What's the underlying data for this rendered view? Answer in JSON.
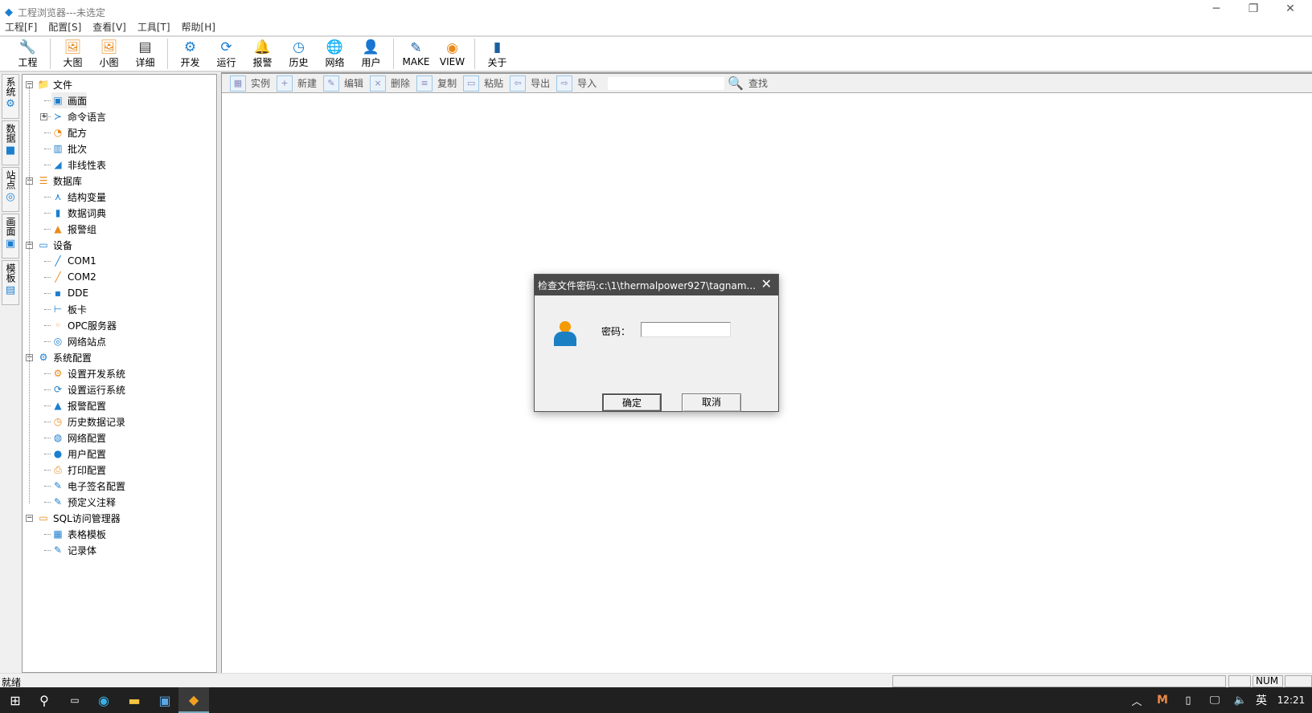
{
  "window": {
    "title": "工程浏览器---未选定",
    "minimize": "─",
    "restore": "❐",
    "close": "✕"
  },
  "menu": [
    "工程[F]",
    "配置[S]",
    "查看[V]",
    "工具[T]",
    "帮助[H]"
  ],
  "toolbar": [
    {
      "label": "工程",
      "icon": "wrench-icon",
      "glyph": "🔧",
      "sep": false
    },
    {
      "label": "大图",
      "icon": "large-icon-view-icon",
      "glyph": "🖼",
      "sep": true
    },
    {
      "label": "小图",
      "icon": "small-icon-view-icon",
      "glyph": "🖼",
      "sep": false
    },
    {
      "label": "详细",
      "icon": "details-icon",
      "glyph": "▤",
      "sep": false
    },
    {
      "label": "开发",
      "icon": "develop-gear-icon",
      "glyph": "⚙",
      "sep": true
    },
    {
      "label": "运行",
      "icon": "run-icon",
      "glyph": "⟳",
      "sep": false
    },
    {
      "label": "报警",
      "icon": "alarm-bell-icon",
      "glyph": "🔔",
      "sep": false
    },
    {
      "label": "历史",
      "icon": "history-clock-icon",
      "glyph": "◷",
      "sep": false
    },
    {
      "label": "网络",
      "icon": "network-globe-icon",
      "glyph": "🌐",
      "sep": false
    },
    {
      "label": "用户",
      "icon": "user-icon",
      "glyph": "👤",
      "sep": false
    },
    {
      "label": "MAKE",
      "icon": "make-edit-icon",
      "glyph": "✎",
      "sep": true
    },
    {
      "label": "VIEW",
      "icon": "view-eye-icon",
      "glyph": "◉",
      "sep": false
    },
    {
      "label": "关于",
      "icon": "about-book-icon",
      "glyph": "▮",
      "sep": true
    }
  ],
  "vtabs": [
    {
      "label": "系统",
      "glyph": "⚙"
    },
    {
      "label": "数据",
      "glyph": "■"
    },
    {
      "label": "站点",
      "glyph": "◎"
    },
    {
      "label": "画面",
      "glyph": "▣"
    },
    {
      "label": "模板",
      "glyph": "▤"
    }
  ],
  "tree": [
    {
      "label": "文件",
      "level": 0,
      "glyph": "📁",
      "exp": "-"
    },
    {
      "label": "画面",
      "level": 1,
      "glyph": "▣"
    },
    {
      "label": "命令语言",
      "level": 1,
      "glyph": "≻",
      "exp": "+"
    },
    {
      "label": "配方",
      "level": 1,
      "glyph": "◔"
    },
    {
      "label": "批次",
      "level": 1,
      "glyph": "▥"
    },
    {
      "label": "非线性表",
      "level": 1,
      "glyph": "◢"
    },
    {
      "label": "数据库",
      "level": 0,
      "glyph": "☰",
      "exp": "-"
    },
    {
      "label": "结构变量",
      "level": 1,
      "glyph": "⋏"
    },
    {
      "label": "数据词典",
      "level": 1,
      "glyph": "▮"
    },
    {
      "label": "报警组",
      "level": 1,
      "glyph": "▲"
    },
    {
      "label": "设备",
      "level": 0,
      "glyph": "▭",
      "exp": "-"
    },
    {
      "label": "COM1",
      "level": 1,
      "glyph": "╱"
    },
    {
      "label": "COM2",
      "level": 1,
      "glyph": "╱"
    },
    {
      "label": "DDE",
      "level": 1,
      "glyph": "▪"
    },
    {
      "label": "板卡",
      "level": 1,
      "glyph": "⊢"
    },
    {
      "label": "OPC服务器",
      "level": 1,
      "glyph": "◦"
    },
    {
      "label": "网络站点",
      "level": 1,
      "glyph": "◎"
    },
    {
      "label": "系统配置",
      "level": 0,
      "glyph": "⚙",
      "exp": "-"
    },
    {
      "label": "设置开发系统",
      "level": 1,
      "glyph": "⚙"
    },
    {
      "label": "设置运行系统",
      "level": 1,
      "glyph": "⟳"
    },
    {
      "label": "报警配置",
      "level": 1,
      "glyph": "▲"
    },
    {
      "label": "历史数据记录",
      "level": 1,
      "glyph": "◷"
    },
    {
      "label": "网络配置",
      "level": 1,
      "glyph": "◍"
    },
    {
      "label": "用户配置",
      "level": 1,
      "glyph": "●"
    },
    {
      "label": "打印配置",
      "level": 1,
      "glyph": "⎙"
    },
    {
      "label": "电子签名配置",
      "level": 1,
      "glyph": "✎"
    },
    {
      "label": "预定义注释",
      "level": 1,
      "glyph": "✎"
    },
    {
      "label": "SQL访问管理器",
      "level": 0,
      "glyph": "▭",
      "exp": "-"
    },
    {
      "label": "表格模板",
      "level": 1,
      "glyph": "▦"
    },
    {
      "label": "记录体",
      "level": 1,
      "glyph": "✎"
    }
  ],
  "subtoolbar": [
    {
      "label": "实例",
      "icon": "instance-icon",
      "glyph": "▦"
    },
    {
      "label": "新建",
      "icon": "new-icon",
      "glyph": "+"
    },
    {
      "label": "编辑",
      "icon": "edit-icon",
      "glyph": "✎"
    },
    {
      "label": "删除",
      "icon": "delete-icon",
      "glyph": "×"
    },
    {
      "label": "复制",
      "icon": "copy-icon",
      "glyph": "≡"
    },
    {
      "label": "粘贴",
      "icon": "paste-icon",
      "glyph": "▭"
    },
    {
      "label": "导出",
      "icon": "export-icon",
      "glyph": "⇦"
    },
    {
      "label": "导入",
      "icon": "import-icon",
      "glyph": "⇨"
    }
  ],
  "find": {
    "value": "",
    "label": "查找"
  },
  "status": {
    "text": "就绪",
    "num": "NUM"
  },
  "taskbar": {
    "time": "12:21",
    "ime": "英"
  },
  "dialog": {
    "title": "检查文件密码:c:\\1\\thermalpower927\\tagnam...",
    "password_label": "密码：",
    "password_value": "",
    "ok": "确定",
    "cancel": "取消"
  }
}
